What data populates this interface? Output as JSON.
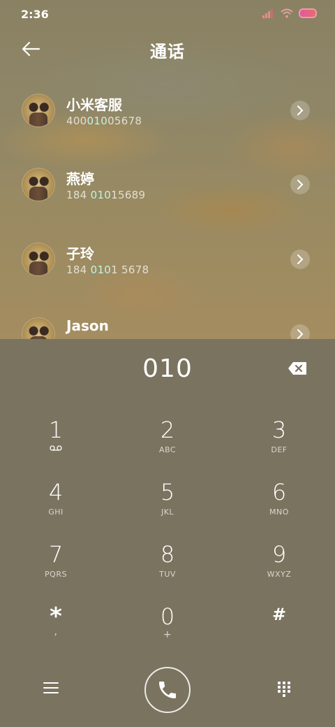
{
  "status": {
    "time": "2:36"
  },
  "header": {
    "title": "通话",
    "back_icon": "back-arrow-icon"
  },
  "contacts": [
    {
      "name": "小米客服",
      "number_pre": "400",
      "number_hl": "010",
      "number_post": "05678"
    },
    {
      "name": "燕婷",
      "number_pre": "184 ",
      "number_hl": "010",
      "number_post": "15689"
    },
    {
      "name": "子玲",
      "number_pre": "184 ",
      "number_hl": "010",
      "number_post": "1 5678"
    },
    {
      "name": "Jason",
      "number_pre": "",
      "number_hl": "",
      "number_post": ""
    }
  ],
  "dialer": {
    "display": "010",
    "keys": [
      {
        "digit": "1",
        "letters": ""
      },
      {
        "digit": "2",
        "letters": "ABC"
      },
      {
        "digit": "3",
        "letters": "DEF"
      },
      {
        "digit": "4",
        "letters": "GHI"
      },
      {
        "digit": "5",
        "letters": "JKL"
      },
      {
        "digit": "6",
        "letters": "MNO"
      },
      {
        "digit": "7",
        "letters": "PQRS"
      },
      {
        "digit": "8",
        "letters": "TUV"
      },
      {
        "digit": "9",
        "letters": "WXYZ"
      },
      {
        "digit": "*",
        "letters": ","
      },
      {
        "digit": "0",
        "letters": "+"
      },
      {
        "digit": "#",
        "letters": ""
      }
    ]
  },
  "colors": {
    "panel": "#7a7360",
    "highlight": "#bff5e6"
  }
}
